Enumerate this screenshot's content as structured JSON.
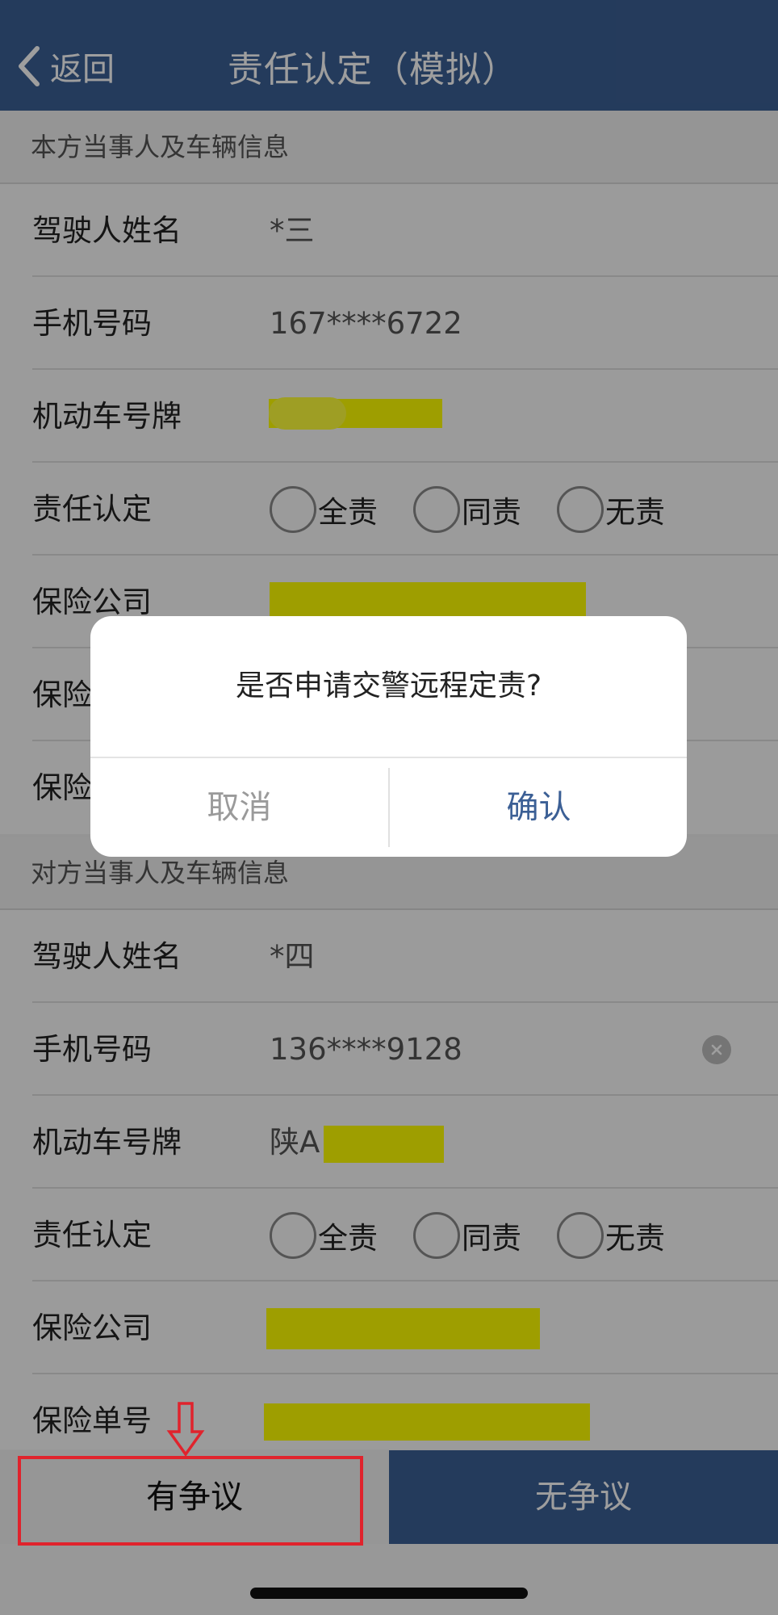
{
  "header": {
    "back_label": "返回",
    "title": "责任认定（模拟）"
  },
  "own_section": {
    "title": "本方当事人及车辆信息",
    "driver_name_label": "驾驶人姓名",
    "driver_name_value": "*三",
    "phone_label": "手机号码",
    "phone_value": "167****6722",
    "plate_label": "机动车号牌",
    "plate_value": "[redacted]",
    "liability_label": "责任认定",
    "liability_options": [
      "全责",
      "同责",
      "无责"
    ],
    "insurer_label": "保险公司",
    "insurer_value": "[redacted]",
    "row6_label_visible": "保险",
    "row7_label_visible": "保险"
  },
  "other_section": {
    "title": "对方当事人及车辆信息",
    "driver_name_label": "驾驶人姓名",
    "driver_name_value": "*四",
    "phone_label": "手机号码",
    "phone_value": "136****9128",
    "plate_label": "机动车号牌",
    "plate_value_visible": "陕A",
    "liability_label": "责任认定",
    "liability_options": [
      "全责",
      "同责",
      "无责"
    ],
    "insurer_label": "保险公司",
    "insurer_value": "[redacted]",
    "policy_no_label": "保险单号",
    "policy_no_value": "[redacted]"
  },
  "actions": {
    "dispute_label": "有争议",
    "no_dispute_label": "无争议"
  },
  "dialog": {
    "message": "是否申请交警远程定责?",
    "cancel_label": "取消",
    "confirm_label": "确认"
  },
  "colors": {
    "brand_navy": "#3b5f95",
    "redaction_yellow": "#ffff00",
    "annotation_red": "#e0232c"
  }
}
